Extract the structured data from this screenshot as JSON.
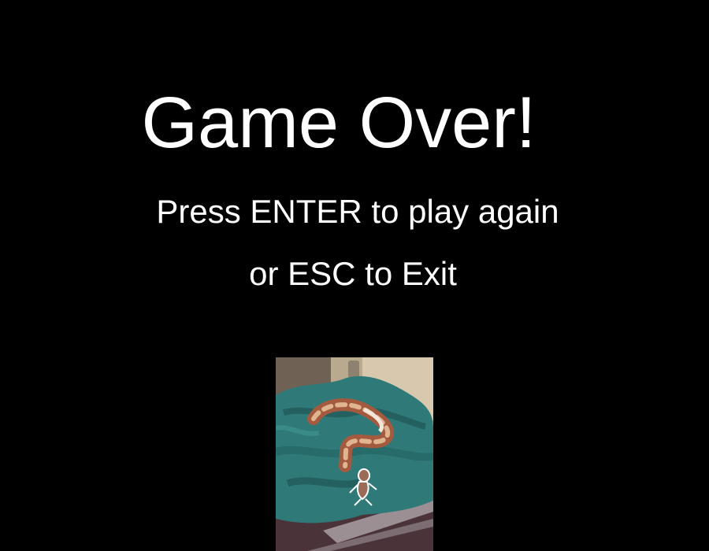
{
  "game_over_screen": {
    "title": "Game Over!",
    "prompt_line_1": "Press ENTER to play again",
    "prompt_line_2": "or ESC to Exit"
  },
  "colors": {
    "background": "#000000",
    "text": "#ffffff"
  },
  "image": {
    "icon": "snake-on-towel-photo"
  }
}
